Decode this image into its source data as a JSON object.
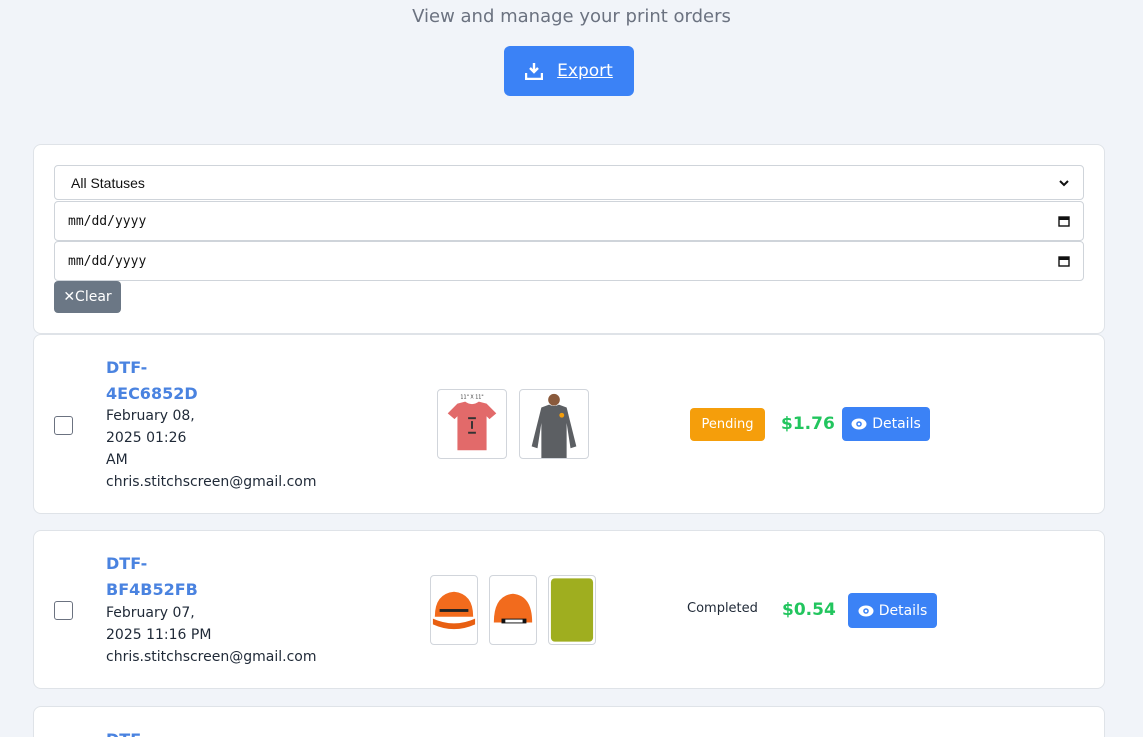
{
  "header": {
    "subtitle": "View and manage your print orders",
    "export_label": "Export"
  },
  "filters": {
    "status_selected": "All Statuses",
    "date_from_placeholder": "mm/dd/yyyy",
    "date_to_placeholder": "mm/dd/yyyy",
    "clear_label": "Clear"
  },
  "orders": [
    {
      "id_line1": "DTF-",
      "id_line2": "4EC6852D",
      "date_line1": "February 08,",
      "date_line2": "2025 01:26",
      "date_line3": "AM",
      "email": "chris.stitchscreen@gmail.com",
      "status": "Pending",
      "price": "$1.76",
      "details_label": "Details",
      "thumb_caption": "11\" X 11\""
    },
    {
      "id_line1": "DTF-",
      "id_line2": "BF4B52FB",
      "date_line1": "February 07,",
      "date_line2": "2025 11:16 PM",
      "email": "chris.stitchscreen@gmail.com",
      "status": "Completed",
      "price": "$0.54",
      "details_label": "Details"
    },
    {
      "id_line1": "DTF-"
    }
  ],
  "colors": {
    "accent": "#3b82f6",
    "pending": "#f59e0b",
    "price": "#22c55e",
    "order_id": "#4a83e0",
    "clear": "#6b7785"
  },
  "icons": {
    "export": "download-icon",
    "details": "eye-icon",
    "clear": "x-icon",
    "date": "calendar-icon",
    "select": "chevron-down-icon"
  }
}
